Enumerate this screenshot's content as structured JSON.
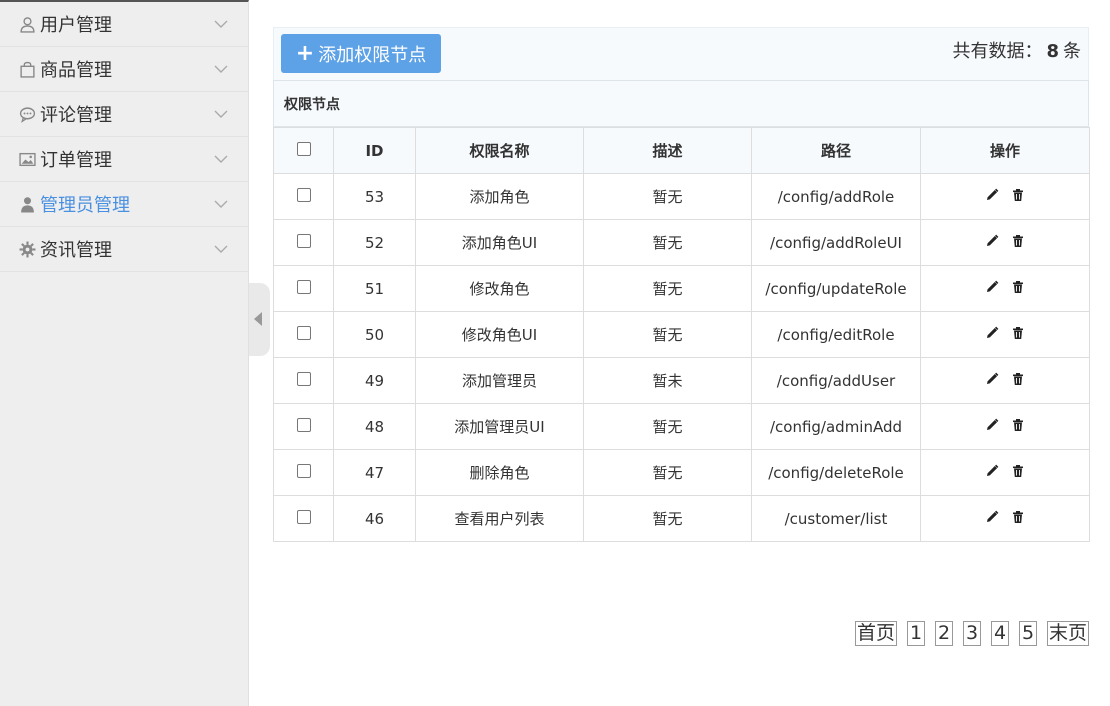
{
  "sidebar": {
    "items": [
      {
        "label": "用户管理",
        "icon": "user-outline-icon",
        "active": false
      },
      {
        "label": "商品管理",
        "icon": "shopping-bag-icon",
        "active": false
      },
      {
        "label": "评论管理",
        "icon": "comment-icon",
        "active": false
      },
      {
        "label": "订单管理",
        "icon": "image-icon",
        "active": false
      },
      {
        "label": "管理员管理",
        "icon": "admin-user-icon",
        "active": true
      },
      {
        "label": "资讯管理",
        "icon": "gear-icon",
        "active": false
      }
    ]
  },
  "toolbar": {
    "add_label": "添加权限节点",
    "total_prefix": "共有数据：",
    "total_count": "8",
    "total_suffix": "条"
  },
  "table": {
    "caption": "权限节点",
    "headers": [
      "ID",
      "权限名称",
      "描述",
      "路径",
      "操作"
    ],
    "rows": [
      {
        "id": "53",
        "name": "添加角色",
        "desc": "暂无",
        "path": "/config/addRole"
      },
      {
        "id": "52",
        "name": "添加角色UI",
        "desc": "暂无",
        "path": "/config/addRoleUI"
      },
      {
        "id": "51",
        "name": "修改角色",
        "desc": "暂无",
        "path": "/config/updateRole"
      },
      {
        "id": "50",
        "name": "修改角色UI",
        "desc": "暂无",
        "path": "/config/editRole"
      },
      {
        "id": "49",
        "name": "添加管理员",
        "desc": "暂未",
        "path": "/config/addUser"
      },
      {
        "id": "48",
        "name": "添加管理员UI",
        "desc": "暂无",
        "path": "/config/adminAdd"
      },
      {
        "id": "47",
        "name": "删除角色",
        "desc": "暂无",
        "path": "/config/deleteRole"
      },
      {
        "id": "46",
        "name": "查看用户列表",
        "desc": "暂无",
        "path": "/customer/list"
      }
    ]
  },
  "pager": {
    "first": "首页",
    "pages": [
      "1",
      "2",
      "3",
      "4",
      "5"
    ],
    "last": "末页"
  },
  "colors": {
    "accent": "#4a90e2",
    "button": "#5da1e6"
  }
}
